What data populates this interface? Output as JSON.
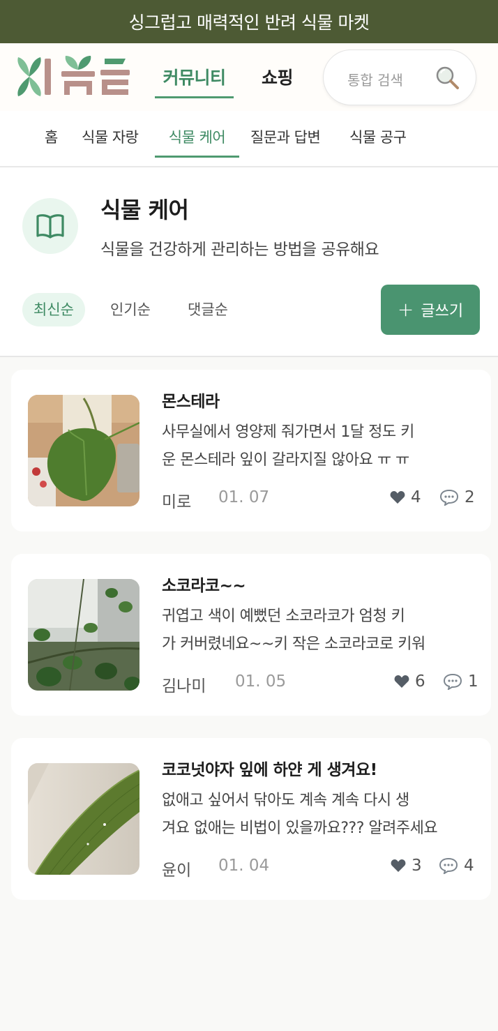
{
  "banner": {
    "text": "싱그럽고 매력적인 반려 식물 마켓"
  },
  "header": {
    "tabs": [
      {
        "label": "커뮤니티",
        "active": true
      },
      {
        "label": "쇼핑",
        "active": false
      }
    ],
    "search": {
      "placeholder": "통합 검색"
    }
  },
  "subnav": {
    "items": [
      {
        "label": "홈",
        "active": false
      },
      {
        "label": "식물 자랑",
        "active": false
      },
      {
        "label": "식물 케어",
        "active": true
      },
      {
        "label": "질문과 답변",
        "active": false
      },
      {
        "label": "식물 공구",
        "active": false
      }
    ]
  },
  "board": {
    "icon": "book-icon",
    "title": "식물 케어",
    "description": "식물을 건강하게 관리하는 방법을 공유해요",
    "sort_options": [
      {
        "label": "최신순",
        "active": true
      },
      {
        "label": "인기순",
        "active": false
      },
      {
        "label": "댓글순",
        "active": false
      }
    ],
    "write_button": {
      "icon": "plus-icon",
      "label": "글쓰기"
    }
  },
  "posts": [
    {
      "title": "몬스테라",
      "body_line1": "사무실에서 영양제 줘가면서 1달 정도 키",
      "body_line2": "운 몬스테라 잎이 갈라지질 않아요 ㅠ ㅠ",
      "author": "미로",
      "date": "01. 07",
      "likes": "4",
      "comments": "2"
    },
    {
      "title": "소코라코~~",
      "body_line1": "귀엽고 색이 예뻤던 소코라코가 엄청 키",
      "body_line2": "가 커버렸네요~~키 작은 소코라코로 키워",
      "author": "김나미",
      "date": "01. 05",
      "likes": "6",
      "comments": "1"
    },
    {
      "title": "코코넛야자 잎에 하얀 게 생겨요!",
      "body_line1": "없애고 싶어서 닦아도 계속 계속 다시 생",
      "body_line2": "겨요 없애는 비법이 있을까요??? 알려주세요",
      "author": "윤이",
      "date": "01. 04",
      "likes": "3",
      "comments": "4"
    }
  ],
  "colors": {
    "banner": "#4d5a34",
    "accent": "#4a9470",
    "accent_light": "#e8f6ee"
  }
}
